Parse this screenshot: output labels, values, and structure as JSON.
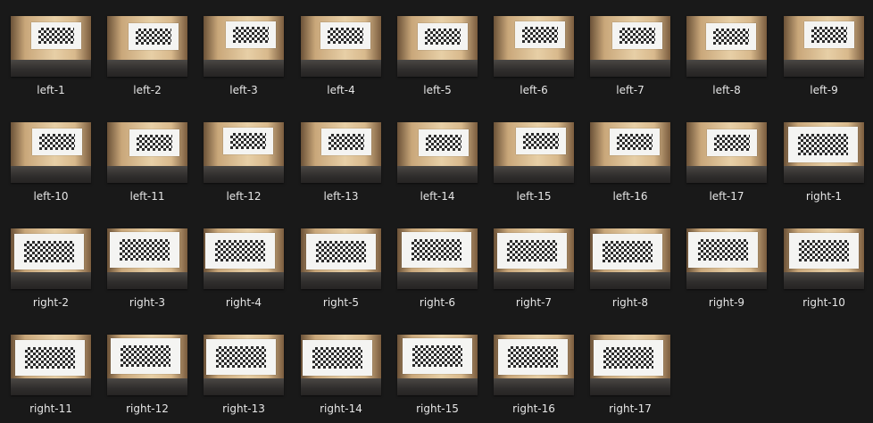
{
  "files": [
    {
      "name": "left-1"
    },
    {
      "name": "left-2"
    },
    {
      "name": "left-3"
    },
    {
      "name": "left-4"
    },
    {
      "name": "left-5"
    },
    {
      "name": "left-6"
    },
    {
      "name": "left-7"
    },
    {
      "name": "left-8"
    },
    {
      "name": "left-9"
    },
    {
      "name": "left-10"
    },
    {
      "name": "left-11"
    },
    {
      "name": "left-12"
    },
    {
      "name": "left-13"
    },
    {
      "name": "left-14"
    },
    {
      "name": "left-15"
    },
    {
      "name": "left-16"
    },
    {
      "name": "left-17"
    },
    {
      "name": "right-1"
    },
    {
      "name": "right-2"
    },
    {
      "name": "right-3"
    },
    {
      "name": "right-4"
    },
    {
      "name": "right-5"
    },
    {
      "name": "right-6"
    },
    {
      "name": "right-7"
    },
    {
      "name": "right-8"
    },
    {
      "name": "right-9"
    },
    {
      "name": "right-10"
    },
    {
      "name": "right-11"
    },
    {
      "name": "right-12"
    },
    {
      "name": "right-13"
    },
    {
      "name": "right-14"
    },
    {
      "name": "right-15"
    },
    {
      "name": "right-16"
    },
    {
      "name": "right-17"
    }
  ],
  "theme": {
    "background": "#191919",
    "label_color": "#e6e6e6"
  }
}
